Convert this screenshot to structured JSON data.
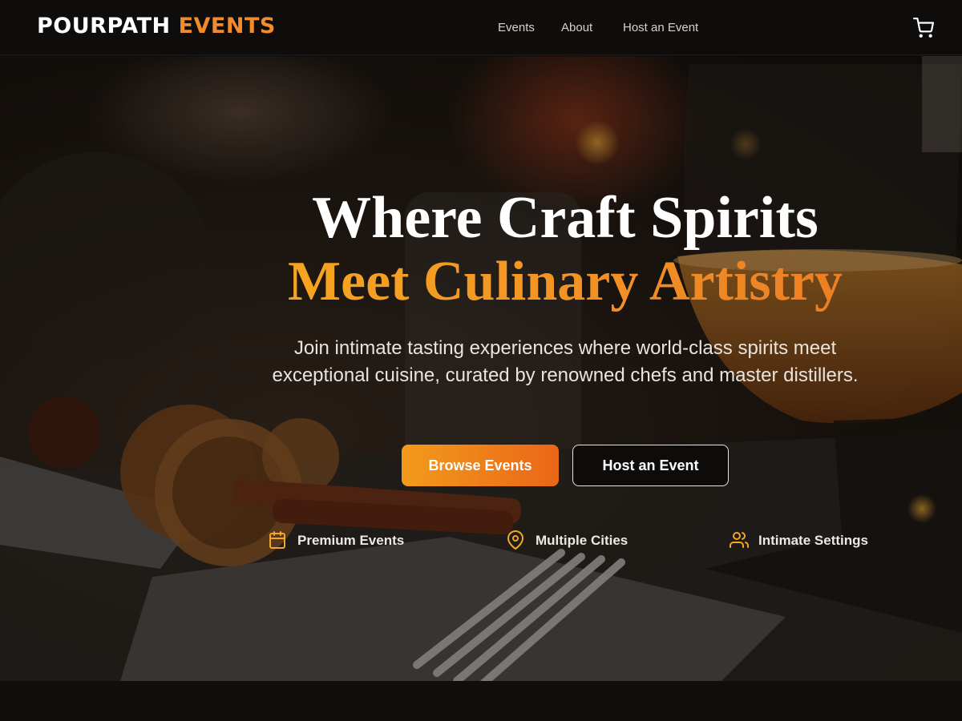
{
  "brand": {
    "name_white": "POURPATH",
    "name_orange": "EVENTS"
  },
  "nav": {
    "links": [
      "Events",
      "About",
      "Host an Event"
    ],
    "cart_icon": "shopping-cart-icon"
  },
  "hero": {
    "title_line1": "Where Craft Spirits",
    "title_line2": "Meet Culinary Artistry",
    "subtitle": "Join intimate tasting experiences where world-class spirits meet exceptional cuisine, curated by renowned chefs and master distillers.",
    "primary_button": "Browse Events",
    "secondary_button": "Host an Event",
    "features": [
      {
        "icon": "calendar-icon",
        "label": "Premium Events"
      },
      {
        "icon": "map-pin-icon",
        "label": "Multiple Cities"
      },
      {
        "icon": "users-icon",
        "label": "Intimate Settings"
      }
    ]
  },
  "colors": {
    "accent_orange": "#f28a2e",
    "gradient_start": "#f39a1b",
    "gradient_end": "#ea6618",
    "background": "#0e0d0c"
  }
}
